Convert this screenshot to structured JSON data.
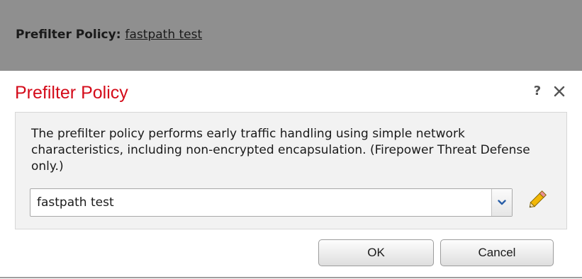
{
  "topbar": {
    "label": "Prefilter Policy:",
    "policy_link": "fastpath test"
  },
  "dialog": {
    "title": "Prefilter Policy",
    "help_icon": "question-mark-icon",
    "help_glyph": "?",
    "close_icon": "close-icon",
    "description": "The prefilter policy performs early traffic handling using simple network characteristics, including non-encrypted encapsulation. (Firepower Threat Defense only.)",
    "select": {
      "value": "fastpath test",
      "arrow_icon": "chevron-down-icon"
    },
    "edit_icon": "pencil-icon",
    "ok_label": "OK",
    "cancel_label": "Cancel"
  },
  "colors": {
    "title_red": "#d40b1a",
    "topbar_gray": "#8f8f8f",
    "panel_bg": "#f2f2f2",
    "arrow_blue": "#2a5fa8",
    "pencil_yellow": "#f2b705"
  }
}
